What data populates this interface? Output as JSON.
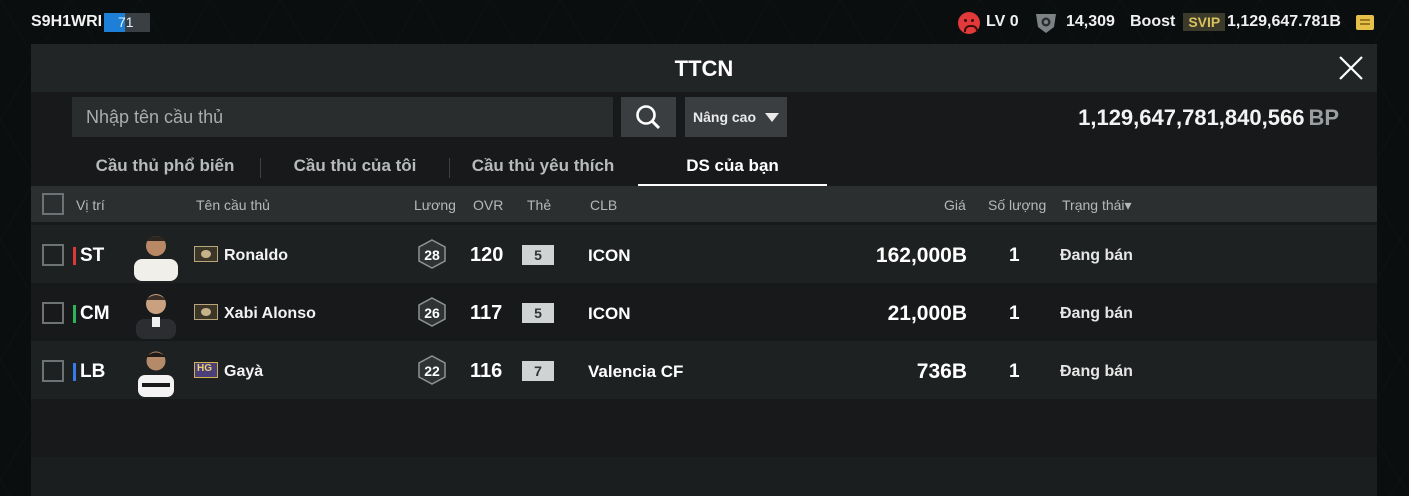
{
  "topbar": {
    "username": "S9H1WRI",
    "level_value": "71",
    "level_progress": 0.45,
    "lv_label": "LV 0",
    "coins": "14,309",
    "boost_label": "Boost",
    "svip_label": "SVIP",
    "balance": "1,129,647.781B"
  },
  "panel": {
    "title": "TTCN",
    "search_placeholder": "Nhập tên cầu thủ",
    "advanced_label": "Nâng cao",
    "bp_value": "1,129,647,781,840,566",
    "bp_unit": "BP"
  },
  "tabs": [
    "Cầu thủ phổ biến",
    "Cầu thủ của tôi",
    "Cầu thủ yêu thích",
    "DS của bạn"
  ],
  "active_tab": 3,
  "table": {
    "headers": {
      "position": "Vị trí",
      "name": "Tên cầu thủ",
      "salary": "Lương",
      "ovr": "OVR",
      "grade": "Thẻ",
      "club": "CLB",
      "price": "Giá",
      "quantity": "Số lượng",
      "status": "Trạng thái▾"
    },
    "rows": [
      {
        "position": "ST",
        "pos_color": "#e0383a",
        "badge": "icon",
        "name": "Ronaldo",
        "salary": "28",
        "ovr": "120",
        "grade": "5",
        "club": "ICON",
        "price": "162,000B",
        "quantity": "1",
        "status": "Đang bán"
      },
      {
        "position": "CM",
        "pos_color": "#2fb35a",
        "badge": "icon",
        "name": "Xabi Alonso",
        "salary": "26",
        "ovr": "117",
        "grade": "5",
        "club": "ICON",
        "price": "21,000B",
        "quantity": "1",
        "status": "Đang bán"
      },
      {
        "position": "LB",
        "pos_color": "#3a7ae8",
        "badge": "HG",
        "name": "Gayà",
        "salary": "22",
        "ovr": "116",
        "grade": "7",
        "club": "Valencia CF",
        "price": "736B",
        "quantity": "1",
        "status": "Đang bán"
      }
    ]
  }
}
